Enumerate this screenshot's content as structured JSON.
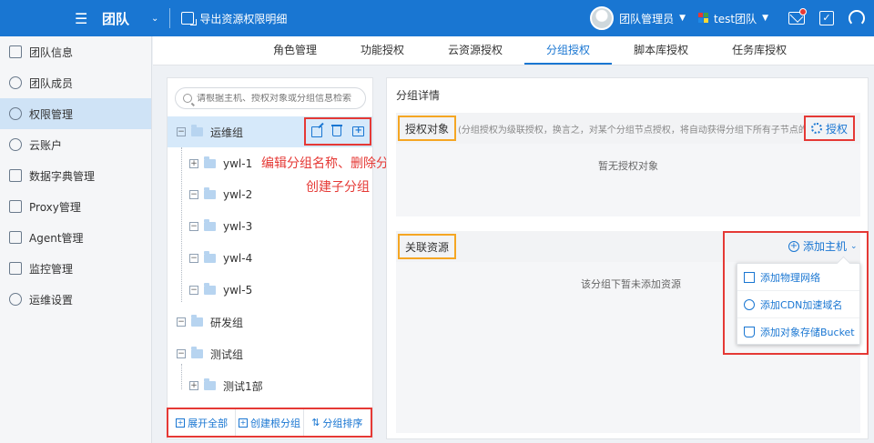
{
  "topbar": {
    "title": "团队",
    "export_label": "导出资源权限明细",
    "user_name": "团队管理员",
    "team_name": "test团队",
    "brand_color": "#1976d2"
  },
  "sidebar": {
    "items": [
      {
        "label": "团队信息",
        "icon": "document-icon"
      },
      {
        "label": "团队成员",
        "icon": "users-icon"
      },
      {
        "label": "权限管理",
        "icon": "user-key-icon"
      },
      {
        "label": "云账户",
        "icon": "cloud-icon"
      },
      {
        "label": "数据字典管理",
        "icon": "book-icon"
      },
      {
        "label": "Proxy管理",
        "icon": "proxy-icon"
      },
      {
        "label": "Agent管理",
        "icon": "agent-icon"
      },
      {
        "label": "监控管理",
        "icon": "monitor-icon"
      },
      {
        "label": "运维设置",
        "icon": "shield-gear-icon"
      }
    ],
    "active_index": 2
  },
  "tabs": [
    {
      "label": "角色管理"
    },
    {
      "label": "功能授权"
    },
    {
      "label": "云资源授权"
    },
    {
      "label": "分组授权"
    },
    {
      "label": "脚本库授权"
    },
    {
      "label": "任务库授权"
    }
  ],
  "tree": {
    "search_placeholder": "请根据主机、授权对象或分组信息检索",
    "nodes": [
      {
        "label": "运维组",
        "toggle": "−"
      },
      {
        "label": "ywl-1",
        "toggle": "+"
      },
      {
        "label": "ywl-2",
        "toggle": "−"
      },
      {
        "label": "ywl-3",
        "toggle": "−"
      },
      {
        "label": "ywl-4",
        "toggle": "−"
      },
      {
        "label": "ywl-5",
        "toggle": "−"
      },
      {
        "label": "研发组",
        "toggle": "−"
      },
      {
        "label": "测试组",
        "toggle": "−"
      },
      {
        "label": "测试1部",
        "toggle": "+"
      }
    ],
    "annotation": "编辑分组名称、删除分组、创建子分组",
    "footer": {
      "expand_all": "展开全部",
      "create_root": "创建根分组",
      "sort": "分组排序"
    }
  },
  "detail": {
    "title": "分组详情",
    "auth_section": {
      "label": "授权对象",
      "hint": "(分组授权为级联授权，换言之，对某个分组节点授权，将自动获得分组下所有子节点的权限)",
      "authorize_button": "授权",
      "empty_text": "暂无授权对象"
    },
    "resource_section": {
      "label": "关联资源",
      "add_host_button": "添加主机",
      "empty_text": "该分组下暂未添加资源",
      "dropdown": [
        {
          "label": "添加物理网络",
          "icon": "network-icon"
        },
        {
          "label": "添加CDN加速域名",
          "icon": "cdn-icon"
        },
        {
          "label": "添加对象存储Bucket",
          "icon": "bucket-icon"
        }
      ]
    }
  }
}
